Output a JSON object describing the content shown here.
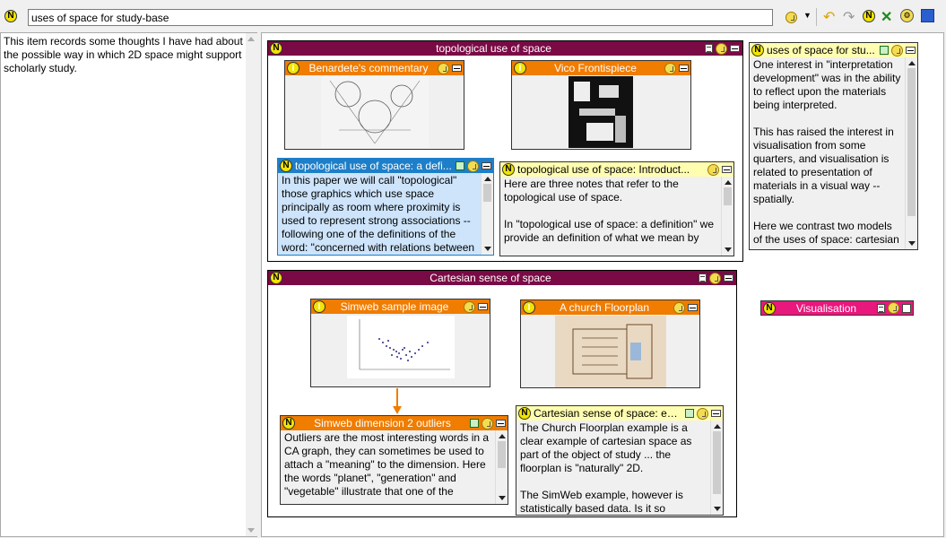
{
  "toolbar": {
    "title_value": "uses of space for study-base"
  },
  "left_panel": {
    "text": "This item records some thoughts I have had about the possible way in which 2D space might support scholarly study."
  },
  "containers": {
    "topological": {
      "title": "topological use of space"
    },
    "cartesian": {
      "title": "Cartesian sense of space"
    }
  },
  "notes": {
    "benardete": {
      "title": "Benardete's commentary"
    },
    "vico": {
      "title": "Vico Frontispiece"
    },
    "topo_def": {
      "title": "topological use of space: a defi...",
      "body": "In this paper we will call \"topological\" those graphics which use space principally as room where proximity is used to represent strong associations -- following one of the definitions of the word: \"concerned with relations between"
    },
    "topo_intro": {
      "title": "topological use of space: Introduct...",
      "body1": "Here are three notes that refer to the topological use of space.",
      "body2": "In \"topological use of space: a definition\" we provide an definition of what we mean by"
    },
    "uses_study": {
      "title": "uses of space for stu...",
      "body1": "One interest in \"interpretation development\" was in the ability to reflect upon the materials being interpreted.",
      "body2": "This has raised the interest in visualisation from some quarters, and visualisation is related to presentation of materials in a visual way -- spatially.",
      "body3": "Here we contrast two models of the uses of space: cartesian"
    },
    "simweb_img": {
      "title": "Simweb sample image"
    },
    "church": {
      "title": "A church Floorplan"
    },
    "outliers": {
      "title": "Simweb dimension 2 outliers",
      "body": "Outliers are the most interesting words in a CA graph, they can sometimes be used to attach a \"meaning\" to the dimension.  Here the words \"planet\", \"generation\" and \"vegetable\" illustrate that one of the"
    },
    "cart_example": {
      "title": "Cartesian sense of space: exa...",
      "body1": "The Church Floorplan example is a clear example of cartesian space as part of the object of study ... the floorplan is \"naturally\" 2D.",
      "body2": "The SimWeb example, however is statistically based data.  Is it so"
    },
    "visualisation": {
      "title": "Visualisation"
    }
  },
  "colors": {
    "maroon": "#7a0a45",
    "orange": "#f07c00",
    "blue": "#1e7fc8",
    "yellow_head": "#fffdb0",
    "magenta": "#e8187c"
  }
}
